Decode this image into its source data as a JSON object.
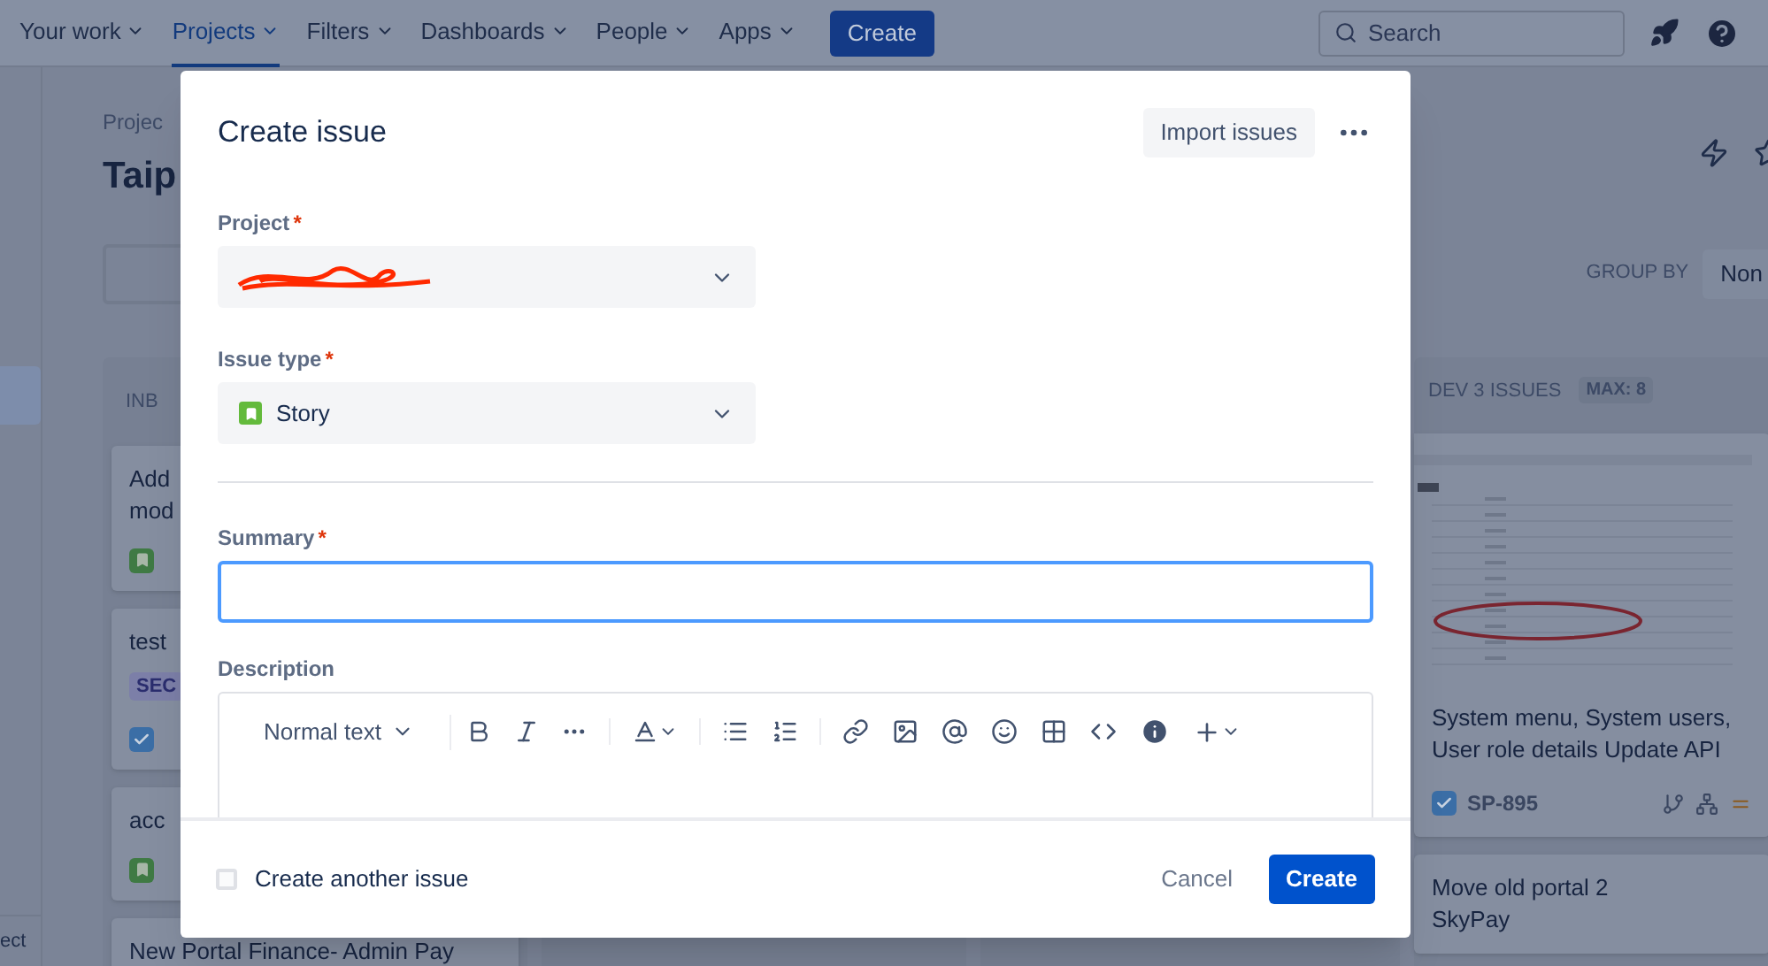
{
  "nav": {
    "items": [
      {
        "label": "Your work",
        "selected": false
      },
      {
        "label": "Projects",
        "selected": true
      },
      {
        "label": "Filters",
        "selected": false
      },
      {
        "label": "Dashboards",
        "selected": false
      },
      {
        "label": "People",
        "selected": false
      },
      {
        "label": "Apps",
        "selected": false
      }
    ],
    "create": "Create",
    "search": {
      "placeholder": "Search"
    }
  },
  "sidebar": {
    "items": [
      {
        "selected": true
      }
    ],
    "footer": "ect"
  },
  "board": {
    "breadcrumb": "Projec",
    "title": "Taip",
    "group_by": {
      "label": "GROUP BY",
      "value": "Non"
    },
    "columns": [
      {
        "title": "INB",
        "cards": [
          {
            "lines": [
              "Add",
              "mod"
            ],
            "kind": "story"
          },
          {
            "lines": [
              "test"
            ],
            "tag": "SEC",
            "kind": "task"
          },
          {
            "lines": [
              "acc"
            ],
            "kind": "story"
          },
          {
            "lines": [
              "New Portal Finance- Admin Pay"
            ]
          }
        ]
      },
      {
        "title": "DEV 3 ISSUES",
        "badge": "MAX: 8",
        "cards": [
          {
            "lines": [
              "System menu, System users,",
              "User role details Update API"
            ],
            "kind": "task",
            "key": "SP-895"
          },
          {
            "lines": [
              "Move old portal 2",
              "SkyPay"
            ]
          }
        ]
      }
    ]
  },
  "dialog": {
    "title": "Create issue",
    "import": "Import issues",
    "required_mark": "*",
    "project": {
      "label": "Project",
      "required": true
    },
    "issue_type": {
      "label": "Issue type",
      "required": true,
      "value": "Story"
    },
    "summary": {
      "label": "Summary",
      "required": true
    },
    "description": {
      "label": "Description",
      "required": false,
      "text_style": "Normal text"
    },
    "another": {
      "label": "Create another issue",
      "checked": false
    },
    "cancel": "Cancel",
    "create": "Create"
  }
}
